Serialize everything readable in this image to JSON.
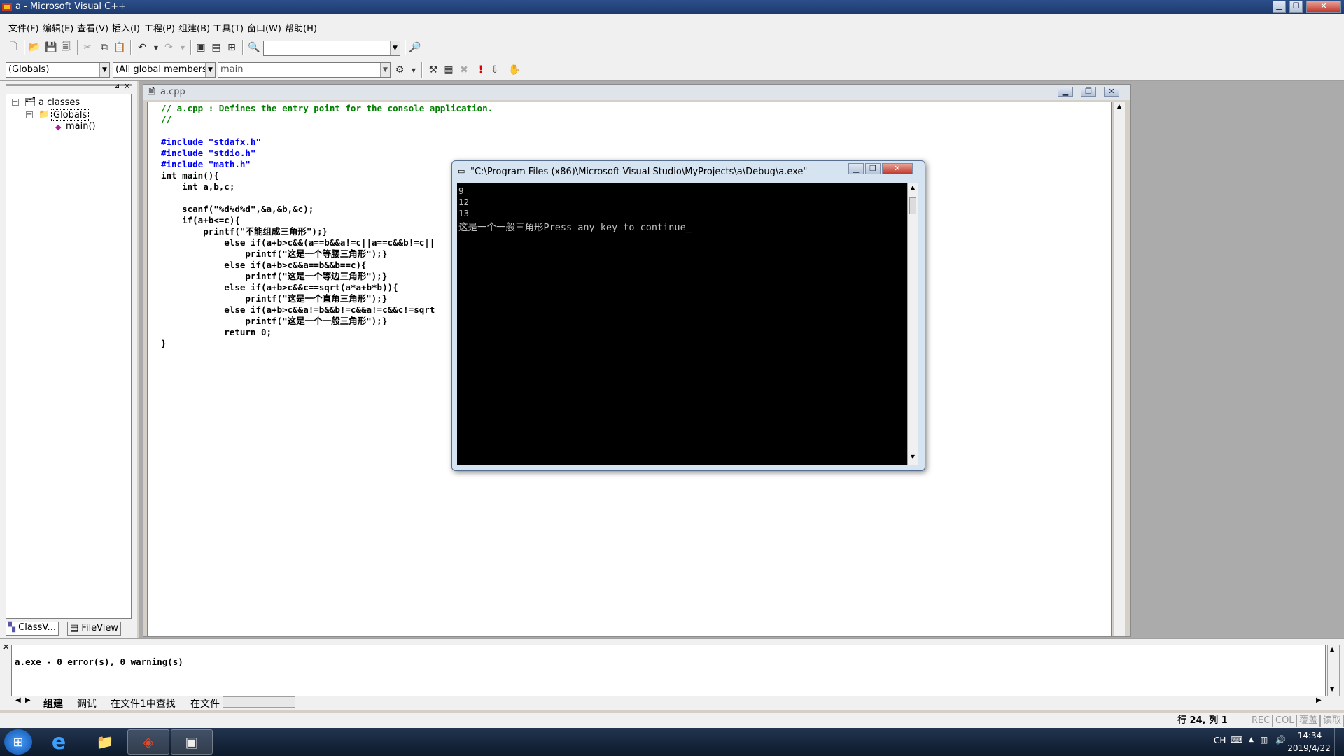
{
  "window": {
    "title": "a - Microsoft Visual C++",
    "min": "▁",
    "max": "❐",
    "close": "✕"
  },
  "menu": [
    "文件(F)",
    "编辑(E)",
    "查看(V)",
    "插入(I)",
    "工程(P)",
    "组建(B)",
    "工具(T)",
    "窗口(W)",
    "帮助(H)"
  ],
  "toolbar2": {
    "scope_combo": "(Globals)",
    "members_combo": "(All global members",
    "function_combo": "main"
  },
  "classview": {
    "root": "a classes",
    "globals": "Globals",
    "func": "main()"
  },
  "workspace_tabs": {
    "classview": "ClassV...",
    "fileview": "FileView"
  },
  "document": {
    "filename": "a.cpp"
  },
  "code": [
    {
      "cls": "cm",
      "text": "// a.cpp : Defines the entry point for the console application."
    },
    {
      "cls": "cm",
      "text": "//"
    },
    {
      "cls": "",
      "text": ""
    },
    {
      "cls": "kw",
      "text": "#include \"stdafx.h\""
    },
    {
      "cls": "kw",
      "text": "#include \"stdio.h\""
    },
    {
      "cls": "kw",
      "text": "#include \"math.h\""
    },
    {
      "cls": "",
      "text": "int main(){"
    },
    {
      "cls": "",
      "text": "    int a,b,c;"
    },
    {
      "cls": "",
      "text": ""
    },
    {
      "cls": "",
      "text": "    scanf(\"%d%d%d\",&a,&b,&c);"
    },
    {
      "cls": "",
      "text": "    if(a+b<=c){"
    },
    {
      "cls": "",
      "text": "        printf(\"不能组成三角形\");}"
    },
    {
      "cls": "",
      "text": "            else if(a+b>c&&(a==b&&a!=c||a==c&&b!=c||"
    },
    {
      "cls": "",
      "text": "                printf(\"这是一个等腰三角形\");}"
    },
    {
      "cls": "",
      "text": "            else if(a+b>c&&a==b&&b==c){"
    },
    {
      "cls": "",
      "text": "                printf(\"这是一个等边三角形\");}"
    },
    {
      "cls": "",
      "text": "            else if(a+b>c&&c==sqrt(a*a+b*b)){"
    },
    {
      "cls": "",
      "text": "                printf(\"这是一个直角三角形\");}"
    },
    {
      "cls": "",
      "text": "            else if(a+b>c&&a!=b&&b!=c&&a!=c&&c!=sqrt"
    },
    {
      "cls": "",
      "text": "                printf(\"这是一个一般三角形\");}"
    },
    {
      "cls": "",
      "text": "            return 0;"
    },
    {
      "cls": "",
      "text": "}"
    }
  ],
  "console": {
    "title": "\"C:\\Program Files (x86)\\Microsoft Visual Studio\\MyProjects\\a\\Debug\\a.exe\"",
    "lines": [
      "9",
      "12",
      "13",
      "这是一个一般三角形Press any key to continue_"
    ]
  },
  "output": {
    "text": "a.exe - 0 error(s), 0 warning(s)",
    "tabs": [
      "组建",
      "调试",
      "在文件1中查找",
      "在文件"
    ]
  },
  "status": {
    "position": "行 24, 列 1",
    "rec": "REC",
    "col": "COL",
    "ovr": "覆盖",
    "read": "读取"
  },
  "taskbar": {
    "lang": "CH",
    "time": "14:34",
    "date": "2019/4/22"
  }
}
